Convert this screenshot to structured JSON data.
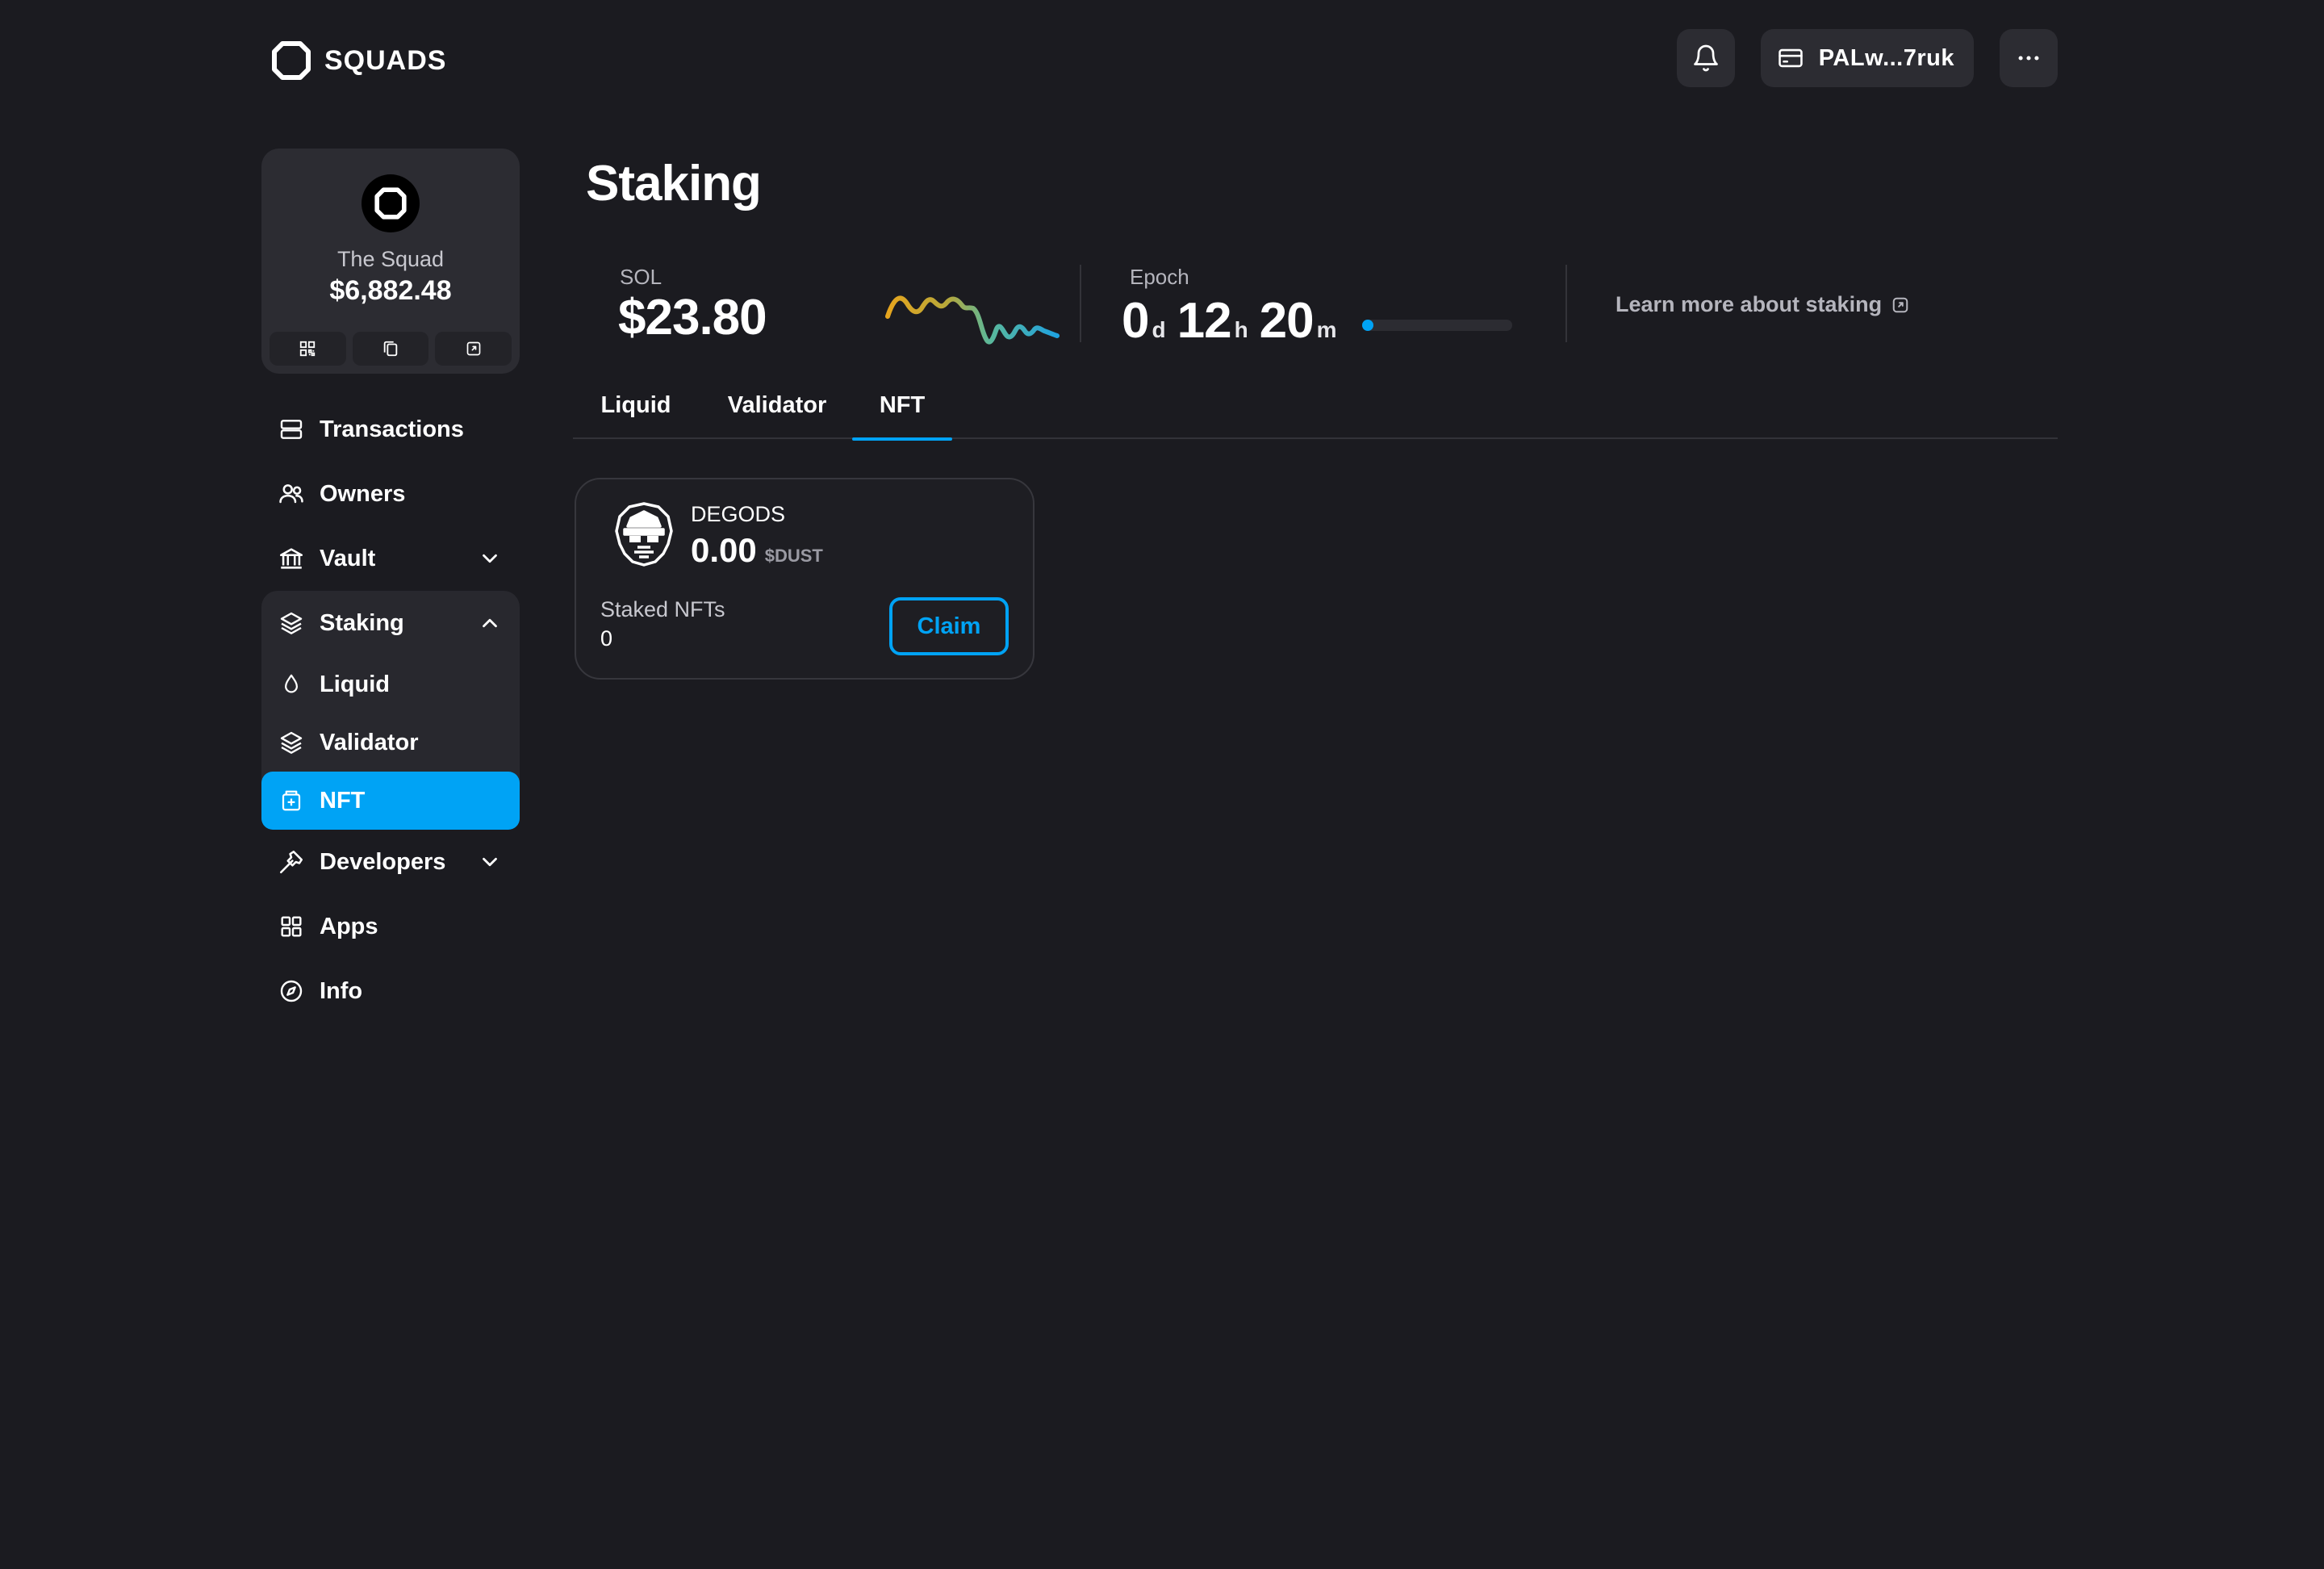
{
  "brand": {
    "name": "SQUADS"
  },
  "header": {
    "wallet_label": "PALw...7ruk",
    "icons": [
      "bell-icon",
      "wallet-icon",
      "more-icon"
    ]
  },
  "squad": {
    "name": "The Squad",
    "balance": "$6,882.48",
    "actions": [
      "qr-code-icon",
      "copy-icon",
      "external-link-icon"
    ]
  },
  "sidebar": {
    "items": [
      {
        "label": "Transactions",
        "icon": "transactions-icon"
      },
      {
        "label": "Owners",
        "icon": "users-icon"
      },
      {
        "label": "Vault",
        "icon": "bank-icon",
        "expandable": true,
        "expanded": false
      },
      {
        "label": "Staking",
        "icon": "layers-icon",
        "expandable": true,
        "expanded": true,
        "children": [
          {
            "label": "Liquid",
            "icon": "droplet-icon"
          },
          {
            "label": "Validator",
            "icon": "layers-icon"
          },
          {
            "label": "NFT",
            "icon": "nft-icon",
            "active": true
          }
        ]
      },
      {
        "label": "Developers",
        "icon": "hammer-icon",
        "expandable": true,
        "expanded": false
      },
      {
        "label": "Apps",
        "icon": "grid-icon"
      },
      {
        "label": "Info",
        "icon": "compass-icon"
      }
    ]
  },
  "main": {
    "title": "Staking",
    "stats": {
      "sol_label": "SOL",
      "sol_price": "$23.80",
      "epoch_label": "Epoch",
      "epoch_days": "0",
      "epoch_days_unit": "d",
      "epoch_hours": "12",
      "epoch_hours_unit": "h",
      "epoch_minutes": "20",
      "epoch_minutes_unit": "m",
      "epoch_progress": 0.05,
      "learn_more": "Learn more about staking"
    },
    "tabs": [
      {
        "label": "Liquid",
        "active": false
      },
      {
        "label": "Validator",
        "active": false
      },
      {
        "label": "NFT",
        "active": true
      }
    ],
    "nft_card": {
      "name": "DEGODS",
      "amount": "0.00",
      "amount_unit": "$DUST",
      "staked_label": "Staked NFTs",
      "staked_count": "0",
      "claim_label": "Claim"
    }
  },
  "colors": {
    "accent": "#00a3f5",
    "background": "#1b1b20",
    "surface": "#2c2c32"
  }
}
